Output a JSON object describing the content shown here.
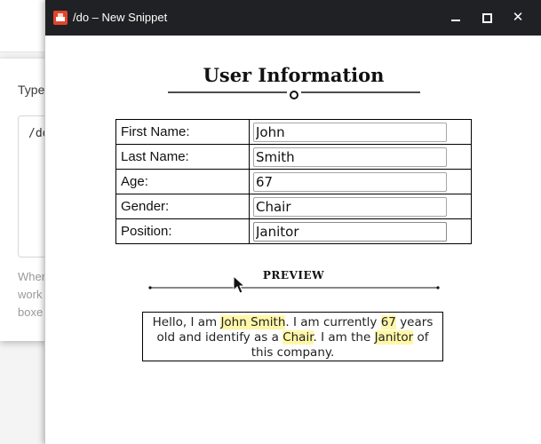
{
  "background": {
    "card_title": "Type",
    "textarea_text": "/do",
    "help_lines": [
      "Wher",
      "work",
      "boxe"
    ]
  },
  "window": {
    "title": "/do – New Snippet",
    "minimize": "",
    "maximize": "",
    "close": "✕"
  },
  "form": {
    "heading": "User Information",
    "rows": [
      {
        "label": "First Name:",
        "value": "John"
      },
      {
        "label": "Last Name:",
        "value": "Smith"
      },
      {
        "label": "Age:",
        "value": "67"
      },
      {
        "label": "Gender:",
        "value": "Chair"
      },
      {
        "label": "Position:",
        "value": "Janitor"
      }
    ]
  },
  "preview": {
    "label": "PREVIEW",
    "text_1": "Hello, I am ",
    "name": "John Smith",
    "text_2": ". I am currently ",
    "age": "67",
    "text_3": " years old and identify as a ",
    "gender": "Chair",
    "text_4": ". I am the ",
    "position": "Janitor",
    "text_5": " of this company."
  },
  "colors": {
    "titlebar": "#202124",
    "highlight": "#fff7a8",
    "app_icon": "#e0452b"
  },
  "icons": {
    "app": "snippet-app-icon",
    "cursor": "mouse-pointer-icon"
  }
}
